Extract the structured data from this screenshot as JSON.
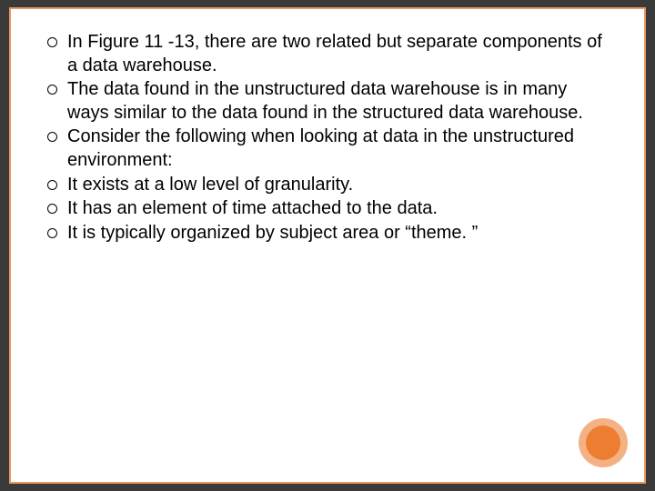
{
  "bullets": [
    "In Figure 11 -13, there are two related but separate components of a data warehouse.",
    "The data found in the unstructured data warehouse is in many ways similar to the data found in the structured data warehouse.",
    "Consider the following when looking at data in the unstructured environment:",
    "It exists at a low level of granularity.",
    " It has an element of time attached to the data.",
    " It is typically organized by subject area or “theme. ”"
  ]
}
